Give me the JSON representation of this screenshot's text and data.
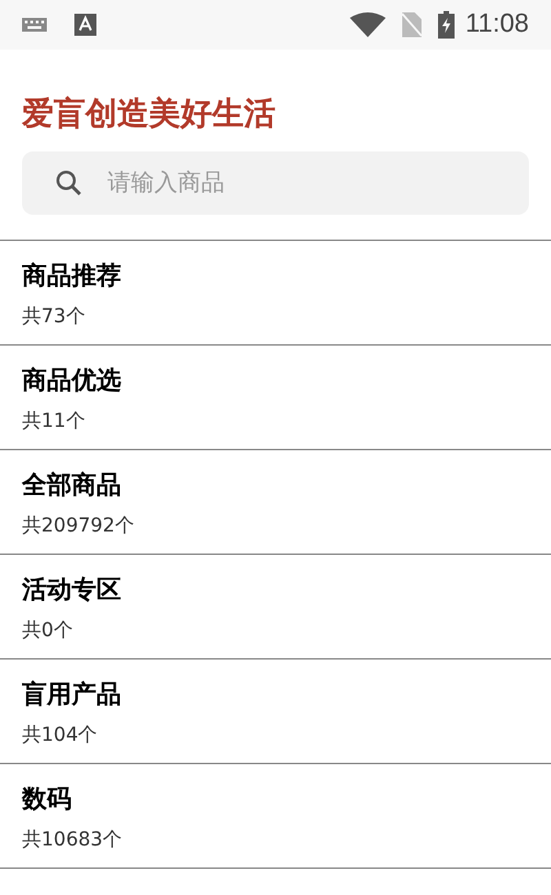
{
  "status_bar": {
    "time": "11:08"
  },
  "header": {
    "title": "爱盲创造美好生活"
  },
  "search": {
    "placeholder": "请输入商品"
  },
  "categories": [
    {
      "name": "商品推荐",
      "count": "共73个"
    },
    {
      "name": "商品优选",
      "count": "共11个"
    },
    {
      "name": "全部商品",
      "count": "共209792个"
    },
    {
      "name": "活动专区",
      "count": "共0个"
    },
    {
      "name": "盲用产品",
      "count": "共104个"
    },
    {
      "name": "数码",
      "count": "共10683个"
    }
  ]
}
